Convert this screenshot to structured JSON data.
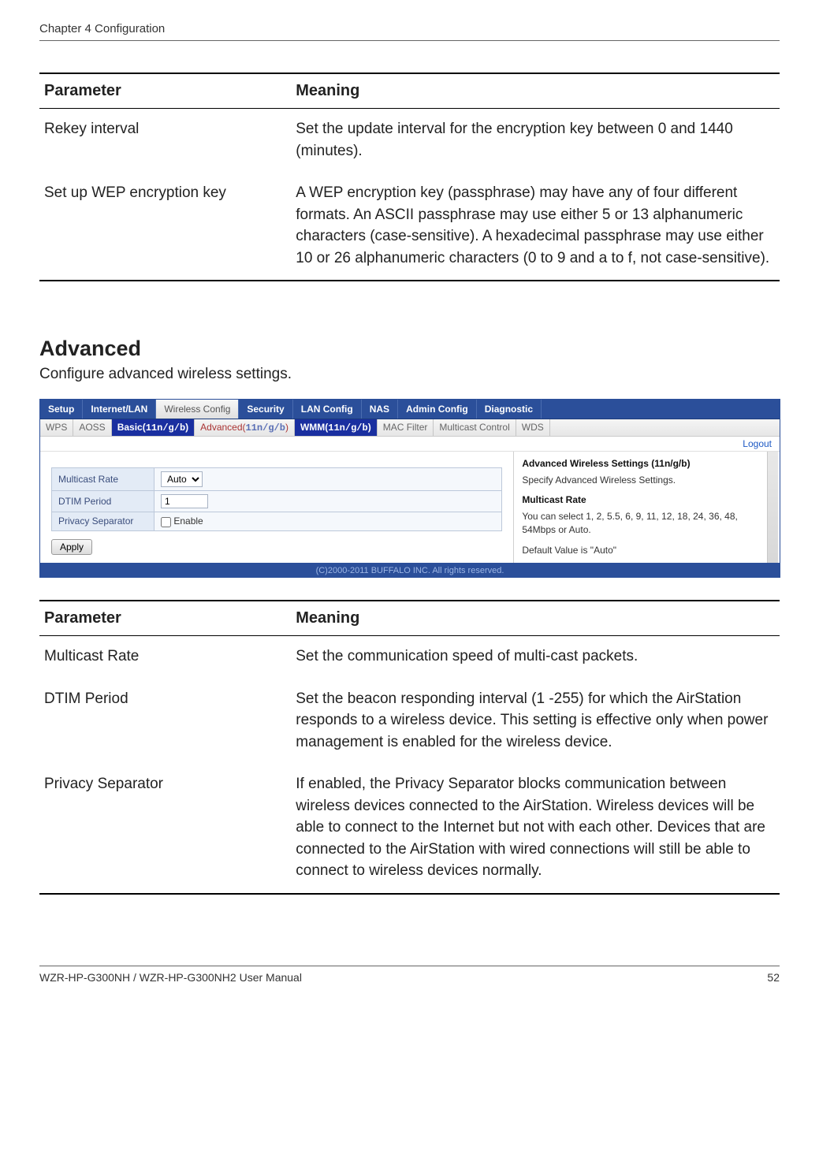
{
  "chapter_header": "Chapter 4  Configuration",
  "table1": {
    "head_param": "Parameter",
    "head_meaning": "Meaning",
    "rows": [
      {
        "param": "Rekey interval",
        "meaning": "Set the update interval for the encryption key between 0 and 1440 (minutes)."
      },
      {
        "param": "Set up WEP encryption key",
        "meaning": "A WEP encryption key (passphrase) may have any of four different formats.  An ASCII passphrase may use either 5 or 13 alphanumeric characters (case-sensitive).  A hexadecimal passphrase may use either 10 or 26 alphanumeric characters (0 to 9 and a to f, not case-sensitive)."
      }
    ]
  },
  "section_title": "Advanced",
  "section_subtitle": "Configure advanced wireless settings.",
  "router": {
    "main_tabs": {
      "t0": "Setup",
      "t1": "Internet/LAN",
      "t2": "Wireless Config",
      "t3": "Security",
      "t4": "LAN Config",
      "t5": "NAS",
      "t6": "Admin Config",
      "t7": "Diagnostic"
    },
    "sub": {
      "wps": "WPS",
      "aoss": "AOSS",
      "basic_label": "Basic(",
      "basic_mono": "11n/g/b",
      "basic_close": ")",
      "adv_label": "Advanced(",
      "adv_mono": "11n/g/b",
      "adv_close": ")",
      "wmm_label": "WMM(",
      "wmm_mono": "11n/g/b",
      "wmm_close": ")",
      "mac": "MAC Filter",
      "multi": "Multicast Control",
      "wds": "WDS"
    },
    "logout": "Logout",
    "form": {
      "multicast_label": "Multicast Rate",
      "multicast_value": "Auto",
      "dtim_label": "DTIM Period",
      "dtim_value": "1",
      "privsep_label": "Privacy Separator",
      "privsep_enable": "Enable",
      "apply": "Apply"
    },
    "help": {
      "h1": "Advanced Wireless Settings (11n/g/b)",
      "p1": "Specify Advanced Wireless Settings.",
      "h2": "Multicast Rate",
      "p2": "You can select 1, 2, 5.5, 6, 9, 11, 12, 18, 24, 36, 48, 54Mbps or Auto.",
      "p3": "Default Value is \"Auto\""
    },
    "copyright": "(C)2000-2011 BUFFALO INC. All rights reserved."
  },
  "table2": {
    "head_param": "Parameter",
    "head_meaning": "Meaning",
    "rows": [
      {
        "param": "Multicast Rate",
        "meaning": "Set the communication speed of multi-cast packets."
      },
      {
        "param": "DTIM Period",
        "meaning": "Set the beacon responding interval (1 -255) for which the AirStation responds to a wireless device. This setting is effective only when power management is enabled for the wireless device."
      },
      {
        "param": "Privacy Separator",
        "meaning": "If enabled, the Privacy Separator blocks communication between wireless devices connected to the AirStation. Wireless devices will be able to connect to the Internet but not with each other. Devices that are connected to the AirStation with wired connections will still be able to connect to wireless devices normally."
      }
    ]
  },
  "footer_left": "WZR-HP-G300NH / WZR-HP-G300NH2 User Manual",
  "footer_right": "52"
}
